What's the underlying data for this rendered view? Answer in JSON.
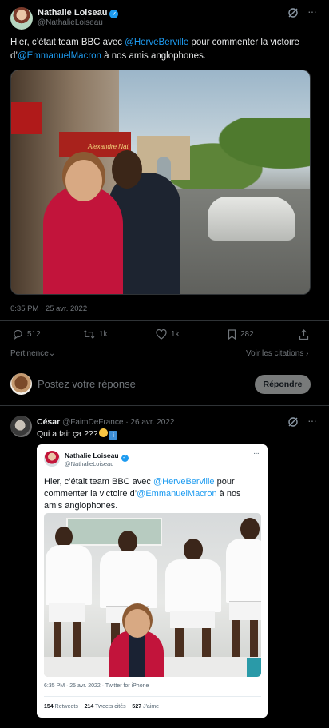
{
  "main_tweet": {
    "author_name": "Nathalie Loiseau",
    "author_handle": "@NathalieLoiseau",
    "text_part1": "Hier, c’était team BBC avec ",
    "mention1": "@HerveBerville",
    "text_part2": " pour commenter la victoire d’",
    "mention2": "@EmmanuelMacron",
    "text_part3": " à nos amis anglophones.",
    "photo_sign": "Alexandre Nat",
    "timestamp": "6:35 PM · 25 avr. 2022",
    "stats": {
      "replies": "512",
      "retweets": "1k",
      "likes": "1k",
      "bookmarks": "282"
    },
    "sort_label": "Pertinence",
    "quotes_link": "Voir les citations"
  },
  "reply_box": {
    "placeholder": "Postez votre réponse",
    "button_label": "Répondre"
  },
  "reply_tweet": {
    "author_name": "César",
    "author_handle": "@FaimDeFrance",
    "date": "· 26 avr. 2022",
    "text": "Qui a fait ça ???",
    "embedded": {
      "author_name": "Nathalie Loiseau",
      "author_handle": "@NathalieLoiseau",
      "text_part1": "Hier, c’était team BBC avec ",
      "mention1": "@HerveBerville",
      "text_part2": " pour commenter la victoire d’",
      "mention2": "@EmmanuelMacron",
      "text_part3": " à nos amis anglophones.",
      "time": "6:35 PM · 25 avr. 2022 · Twitter for iPhone",
      "retweets_count": "154",
      "retweets_label": "Retweets",
      "quotes_count": "214",
      "quotes_label": "Tweets cités",
      "likes_count": "527",
      "likes_label": "J'aime"
    }
  },
  "icons": {
    "verified": "verified-badge-icon",
    "grok": "grok-icon",
    "more": "more-icon",
    "reply": "reply-icon",
    "retweet": "retweet-icon",
    "like": "heart-icon",
    "bookmark": "bookmark-icon",
    "share": "share-icon"
  },
  "colors": {
    "background": "#000000",
    "accent": "#1d9bf0",
    "muted": "#71767b",
    "divider": "#2f3336"
  }
}
